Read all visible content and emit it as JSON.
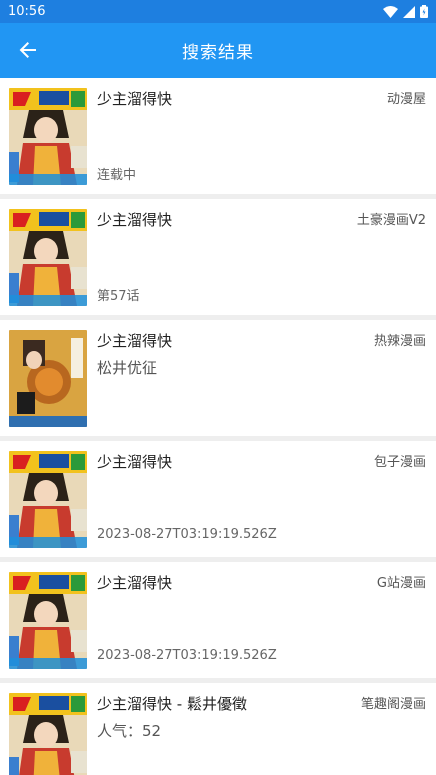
{
  "statusbar": {
    "time": "10:56"
  },
  "appbar": {
    "title": "搜索结果"
  },
  "colors": {
    "primary": "#2196f3",
    "statusbar": "#1e7fe0"
  },
  "results": [
    {
      "title": "少主溜得快",
      "source": "动漫屋",
      "author": "",
      "status": "连载中",
      "cover": "jump"
    },
    {
      "title": "少主溜得快",
      "source": "土豪漫画V2",
      "author": "",
      "status": "第57话",
      "cover": "jump"
    },
    {
      "title": "少主溜得快",
      "source": "热辣漫画",
      "author": "松井优征",
      "status": "",
      "cover": "volume"
    },
    {
      "title": "少主溜得快",
      "source": "包子漫画",
      "author": "",
      "status": "2023-08-27T03:19:19.526Z",
      "cover": "jump"
    },
    {
      "title": "少主溜得快",
      "source": "G站漫画",
      "author": "",
      "status": "2023-08-27T03:19:19.526Z",
      "cover": "jump"
    },
    {
      "title": "少主溜得快 - 鬆井優徵",
      "source": "笔趣阁漫画",
      "author": "人气：52",
      "status": "",
      "cover": "jump"
    }
  ]
}
